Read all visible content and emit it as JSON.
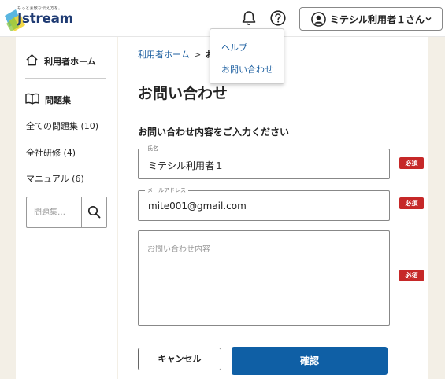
{
  "header": {
    "logo_tagline": "もっと素敵な伝え方を。",
    "logo_text": "Jstream",
    "user_name": "ミテシル利用者１さん"
  },
  "help_menu": {
    "items": [
      "ヘルプ",
      "お問い合わせ"
    ]
  },
  "sidebar": {
    "home_label": "利用者ホーム",
    "group_label": "問題集",
    "items": [
      {
        "label": "全ての問題集 (10)"
      },
      {
        "label": "全社研修 (4)"
      },
      {
        "label": "マニュアル (6)"
      }
    ],
    "search_placeholder": "問題集…"
  },
  "main": {
    "breadcrumb": {
      "home": "利用者ホーム",
      "separator": ">",
      "current": "お"
    },
    "title": "お問い合わせ",
    "section_title": "お問い合わせ内容をご入力ください",
    "fields": {
      "name": {
        "label": "氏名",
        "value": "ミテシル利用者１"
      },
      "email": {
        "label": "メールアドレス",
        "value": "mite001@gmail.com"
      },
      "message": {
        "placeholder": "お問い合わせ内容"
      }
    },
    "required_label": "必須",
    "cancel_label": "キャンセル",
    "confirm_label": "確認"
  },
  "colors": {
    "accent": "#0f5fa5",
    "link": "#1c5fa0",
    "required": "#c62828",
    "background": "#f3efe6"
  }
}
